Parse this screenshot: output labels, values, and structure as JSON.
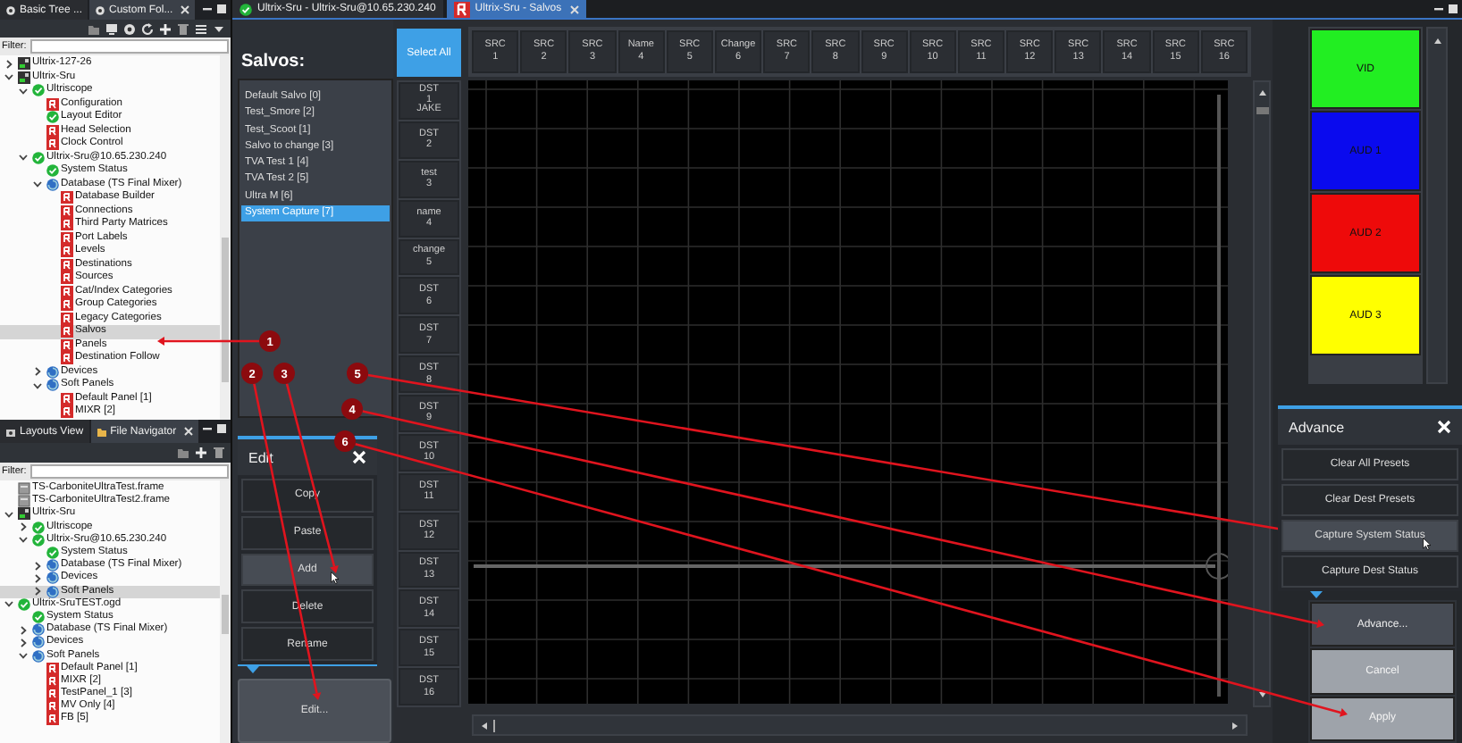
{
  "left_top_panel": {
    "tabs": [
      {
        "label": "Basic Tree ...",
        "selected": false
      },
      {
        "label": "Custom Fol...",
        "selected": true
      }
    ],
    "filter_label": "Filter:",
    "tree": [
      {
        "label": "Ultrix-127-26",
        "kind": "device",
        "expanded": false,
        "selected": false
      },
      {
        "label": "Ultrix-Sru",
        "kind": "device",
        "expanded": true,
        "selected": false,
        "children": [
          {
            "label": "Ultriscope",
            "kind": "status",
            "expanded": true,
            "selected": false,
            "children": [
              {
                "label": "Configuration",
                "kind": "panel",
                "selected": false
              },
              {
                "label": "Layout Editor",
                "kind": "status",
                "selected": false
              },
              {
                "label": "Head Selection",
                "kind": "panel",
                "selected": false
              },
              {
                "label": "Clock Control",
                "kind": "panel",
                "selected": false
              }
            ]
          },
          {
            "label": "Ultrix-Sru@10.65.230.240",
            "kind": "status",
            "expanded": true,
            "selected": false,
            "children": [
              {
                "label": "System Status",
                "kind": "status",
                "selected": false
              },
              {
                "label": "Database (TS Final Mixer)",
                "kind": "database",
                "expanded": true,
                "selected": false,
                "children": [
                  {
                    "label": "Database Builder",
                    "kind": "panel",
                    "selected": false
                  },
                  {
                    "label": "Connections",
                    "kind": "panel",
                    "selected": false
                  },
                  {
                    "label": "Third Party Matrices",
                    "kind": "panel",
                    "selected": false
                  },
                  {
                    "label": "Port Labels",
                    "kind": "panel",
                    "selected": false
                  },
                  {
                    "label": "Levels",
                    "kind": "panel",
                    "selected": false
                  },
                  {
                    "label": "Destinations",
                    "kind": "panel",
                    "selected": false
                  },
                  {
                    "label": "Sources",
                    "kind": "panel",
                    "selected": false
                  },
                  {
                    "label": "Cat/Index Categories",
                    "kind": "panel",
                    "selected": false
                  },
                  {
                    "label": "Group Categories",
                    "kind": "panel",
                    "selected": false
                  },
                  {
                    "label": "Legacy Categories",
                    "kind": "panel",
                    "selected": false
                  },
                  {
                    "label": "Salvos",
                    "kind": "panel",
                    "selected": true
                  },
                  {
                    "label": "Panels",
                    "kind": "panel",
                    "selected": false
                  },
                  {
                    "label": "Destination Follow",
                    "kind": "panel",
                    "selected": false
                  }
                ]
              },
              {
                "label": "Devices",
                "kind": "database",
                "expanded": false,
                "selected": false
              },
              {
                "label": "Soft Panels",
                "kind": "database",
                "expanded": true,
                "selected": false,
                "children": [
                  {
                    "label": "Default Panel [1]",
                    "kind": "panel",
                    "selected": false
                  },
                  {
                    "label": "MIXR [2]",
                    "kind": "panel",
                    "selected": false
                  }
                ]
              }
            ]
          }
        ]
      }
    ]
  },
  "left_bottom_panel": {
    "tabs": [
      {
        "label": "Layouts View",
        "selected": false
      },
      {
        "label": "File Navigator",
        "selected": true
      }
    ],
    "filter_label": "Filter:",
    "tree": [
      {
        "label": "TS-CarboniteUltraTest.frame",
        "kind": "file",
        "selected": false
      },
      {
        "label": "TS-CarboniteUltraTest2.frame",
        "kind": "file",
        "selected": false
      },
      {
        "label": "Ultrix-Sru",
        "kind": "device",
        "expanded": true,
        "selected": false,
        "children": [
          {
            "label": "Ultriscope",
            "kind": "status",
            "expanded": false,
            "selected": false
          },
          {
            "label": "Ultrix-Sru@10.65.230.240",
            "kind": "status",
            "expanded": true,
            "selected": false,
            "children": [
              {
                "label": "System Status",
                "kind": "status",
                "selected": false
              },
              {
                "label": "Database (TS Final Mixer)",
                "kind": "database",
                "expanded": false,
                "selected": false
              },
              {
                "label": "Devices",
                "kind": "database",
                "expanded": false,
                "selected": false
              },
              {
                "label": "Soft Panels",
                "kind": "database",
                "expanded": false,
                "selected": true
              }
            ]
          }
        ]
      },
      {
        "label": "Ultrix-SruTEST.ogd",
        "kind": "status",
        "expanded": true,
        "selected": false,
        "children": [
          {
            "label": "System Status",
            "kind": "status",
            "selected": false
          },
          {
            "label": "Database (TS Final Mixer)",
            "kind": "database",
            "expanded": false,
            "selected": false
          },
          {
            "label": "Devices",
            "kind": "database",
            "expanded": false,
            "selected": false
          },
          {
            "label": "Soft Panels",
            "kind": "database",
            "expanded": true,
            "selected": false,
            "children": [
              {
                "label": "Default Panel [1]",
                "kind": "panel",
                "selected": false
              },
              {
                "label": "MIXR [2]",
                "kind": "panel",
                "selected": false
              },
              {
                "label": "TestPanel_1 [3]",
                "kind": "panel",
                "selected": false
              },
              {
                "label": "MV Only [4]",
                "kind": "panel",
                "selected": false
              },
              {
                "label": "FB [5]",
                "kind": "panel",
                "selected": false
              }
            ]
          }
        ]
      }
    ]
  },
  "document_tabs": [
    {
      "label": "Ultrix-Sru - Ultrix-Sru@10.65.230.240",
      "kind": "status",
      "selected": false
    },
    {
      "label": "Ultrix-Sru - Salvos",
      "kind": "panel",
      "selected": true
    }
  ],
  "salvos": {
    "title": "Salvos:",
    "items": [
      {
        "label": "Default Salvo [0]",
        "selected": false
      },
      {
        "label": "Test_Smore [2]",
        "selected": false
      },
      {
        "label": "Test_Scoot [1]",
        "selected": false
      },
      {
        "label": "Salvo to change [3]",
        "selected": false
      },
      {
        "label": "TVA Test 1 [4]",
        "selected": false
      },
      {
        "label": "TVA Test 2 [5]",
        "selected": false
      },
      {
        "label": "Ultra M [6]",
        "selected": false
      },
      {
        "label": "System Capture [7]",
        "selected": true
      }
    ]
  },
  "edit_panel": {
    "title": "Edit",
    "buttons": [
      {
        "label": "Copy",
        "hovered": false
      },
      {
        "label": "Paste",
        "hovered": false
      },
      {
        "label": "Add",
        "hovered": true
      },
      {
        "label": "Delete",
        "hovered": false
      },
      {
        "label": "Rename",
        "hovered": false
      }
    ]
  },
  "edit_button": "Edit...",
  "grid": {
    "select_all": "Select All",
    "sources": [
      {
        "name": "SRC",
        "number": "1"
      },
      {
        "name": "SRC",
        "number": "2"
      },
      {
        "name": "SRC",
        "number": "3"
      },
      {
        "name": "Name",
        "number": "4"
      },
      {
        "name": "SRC",
        "number": "5"
      },
      {
        "name": "Change",
        "number": "6"
      },
      {
        "name": "SRC",
        "number": "7"
      },
      {
        "name": "SRC",
        "number": "8"
      },
      {
        "name": "SRC",
        "number": "9"
      },
      {
        "name": "SRC",
        "number": "10"
      },
      {
        "name": "SRC",
        "number": "11"
      },
      {
        "name": "SRC",
        "number": "12"
      },
      {
        "name": "SRC",
        "number": "13"
      },
      {
        "name": "SRC",
        "number": "14"
      },
      {
        "name": "SRC",
        "number": "15"
      },
      {
        "name": "SRC",
        "number": "16"
      }
    ],
    "destinations": [
      {
        "name": "DST",
        "number": "1",
        "alias": "JAKE"
      },
      {
        "name": "DST",
        "number": "2"
      },
      {
        "name": "test",
        "number": "3"
      },
      {
        "name": "name",
        "number": "4"
      },
      {
        "name": "change",
        "number": "5"
      },
      {
        "name": "DST",
        "number": "6"
      },
      {
        "name": "DST",
        "number": "7"
      },
      {
        "name": "DST",
        "number": "8"
      },
      {
        "name": "DST",
        "number": "9"
      },
      {
        "name": "DST",
        "number": "10"
      },
      {
        "name": "DST",
        "number": "11"
      },
      {
        "name": "DST",
        "number": "12"
      },
      {
        "name": "DST",
        "number": "13"
      },
      {
        "name": "DST",
        "number": "14"
      },
      {
        "name": "DST",
        "number": "15"
      },
      {
        "name": "DST",
        "number": "16"
      }
    ]
  },
  "levels": [
    {
      "label": "VID",
      "color": "#22ee22"
    },
    {
      "label": "AUD 1",
      "color": "#0a0aee"
    },
    {
      "label": "AUD 2",
      "color": "#ee0a0a"
    },
    {
      "label": "AUD 3",
      "color": "#ffff00"
    }
  ],
  "advance_panel": {
    "title": "Advance",
    "buttons": [
      {
        "label": "Clear All Presets",
        "hovered": false
      },
      {
        "label": "Clear Dest Presets",
        "hovered": false
      },
      {
        "label": "Capture System Status",
        "hovered": true
      },
      {
        "label": "Capture Dest Status",
        "hovered": false
      }
    ]
  },
  "action_buttons": [
    {
      "label": "Advance...",
      "kind": "dark"
    },
    {
      "label": "Cancel",
      "kind": "light"
    },
    {
      "label": "Apply",
      "kind": "light"
    }
  ],
  "callouts": [
    {
      "label": "1"
    },
    {
      "label": "2"
    },
    {
      "label": "3"
    },
    {
      "label": "5"
    },
    {
      "label": "4"
    },
    {
      "label": "6"
    }
  ]
}
